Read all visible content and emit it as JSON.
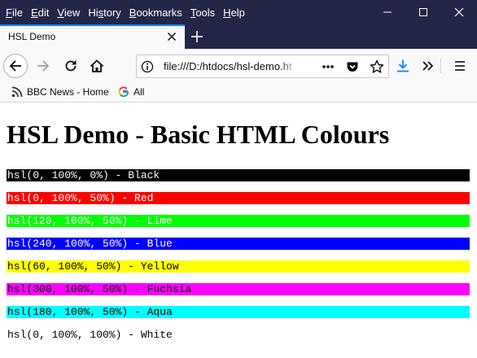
{
  "menubar": {
    "items": [
      {
        "label": "File",
        "acc": "F",
        "rest": "ile"
      },
      {
        "label": "Edit",
        "acc": "E",
        "rest": "dit"
      },
      {
        "label": "View",
        "acc": "V",
        "rest": "iew"
      },
      {
        "label": "History",
        "acc": "",
        "pre": "Hi",
        "acc2": "s",
        "rest": "tory"
      },
      {
        "label": "Bookmarks",
        "acc": "B",
        "rest": "ookmarks"
      },
      {
        "label": "Tools",
        "acc": "T",
        "rest": "ools"
      },
      {
        "label": "Help",
        "acc": "H",
        "rest": "elp"
      }
    ]
  },
  "tabs": [
    {
      "title": "HSL Demo",
      "active": true
    }
  ],
  "navbar": {
    "url": "file:///D:/htdocs/hsl-demo.html"
  },
  "bookmarks": [
    {
      "label": "BBC News - Home",
      "icon": "rss-icon"
    },
    {
      "label": "All",
      "icon": "google-icon"
    }
  ],
  "page": {
    "title": "HSL Demo - Basic HTML Colours",
    "colors": [
      {
        "label": "hsl(0, 100%, 0%) - Black",
        "bg": "#000000",
        "fg": "#ffffff"
      },
      {
        "label": "hsl(0, 100%, 50%) - Red",
        "bg": "#ff0000",
        "fg": "#ffffff"
      },
      {
        "label": "hsl(120, 100%, 50%) - Lime",
        "bg": "#00ff00",
        "fg": "#ffffff"
      },
      {
        "label": "hsl(240, 100%, 50%) - Blue",
        "bg": "#0000ff",
        "fg": "#ffffff"
      },
      {
        "label": "hsl(60, 100%, 50%) - Yellow",
        "bg": "#ffff00",
        "fg": "#000000"
      },
      {
        "label": "hsl(300, 100%, 50%) - Fuchsia",
        "bg": "#ff00ff",
        "fg": "#000000"
      },
      {
        "label": "hsl(180, 100%, 50%) - Aqua",
        "bg": "#00ffff",
        "fg": "#000000"
      },
      {
        "label": "hsl(0, 100%, 100%) - White",
        "bg": "#ffffff",
        "fg": "#000000"
      }
    ]
  },
  "theme": {
    "titlebar_bg": "#242648",
    "tab_accent": "#0a84ff",
    "download_accent": "#0a84ff"
  }
}
